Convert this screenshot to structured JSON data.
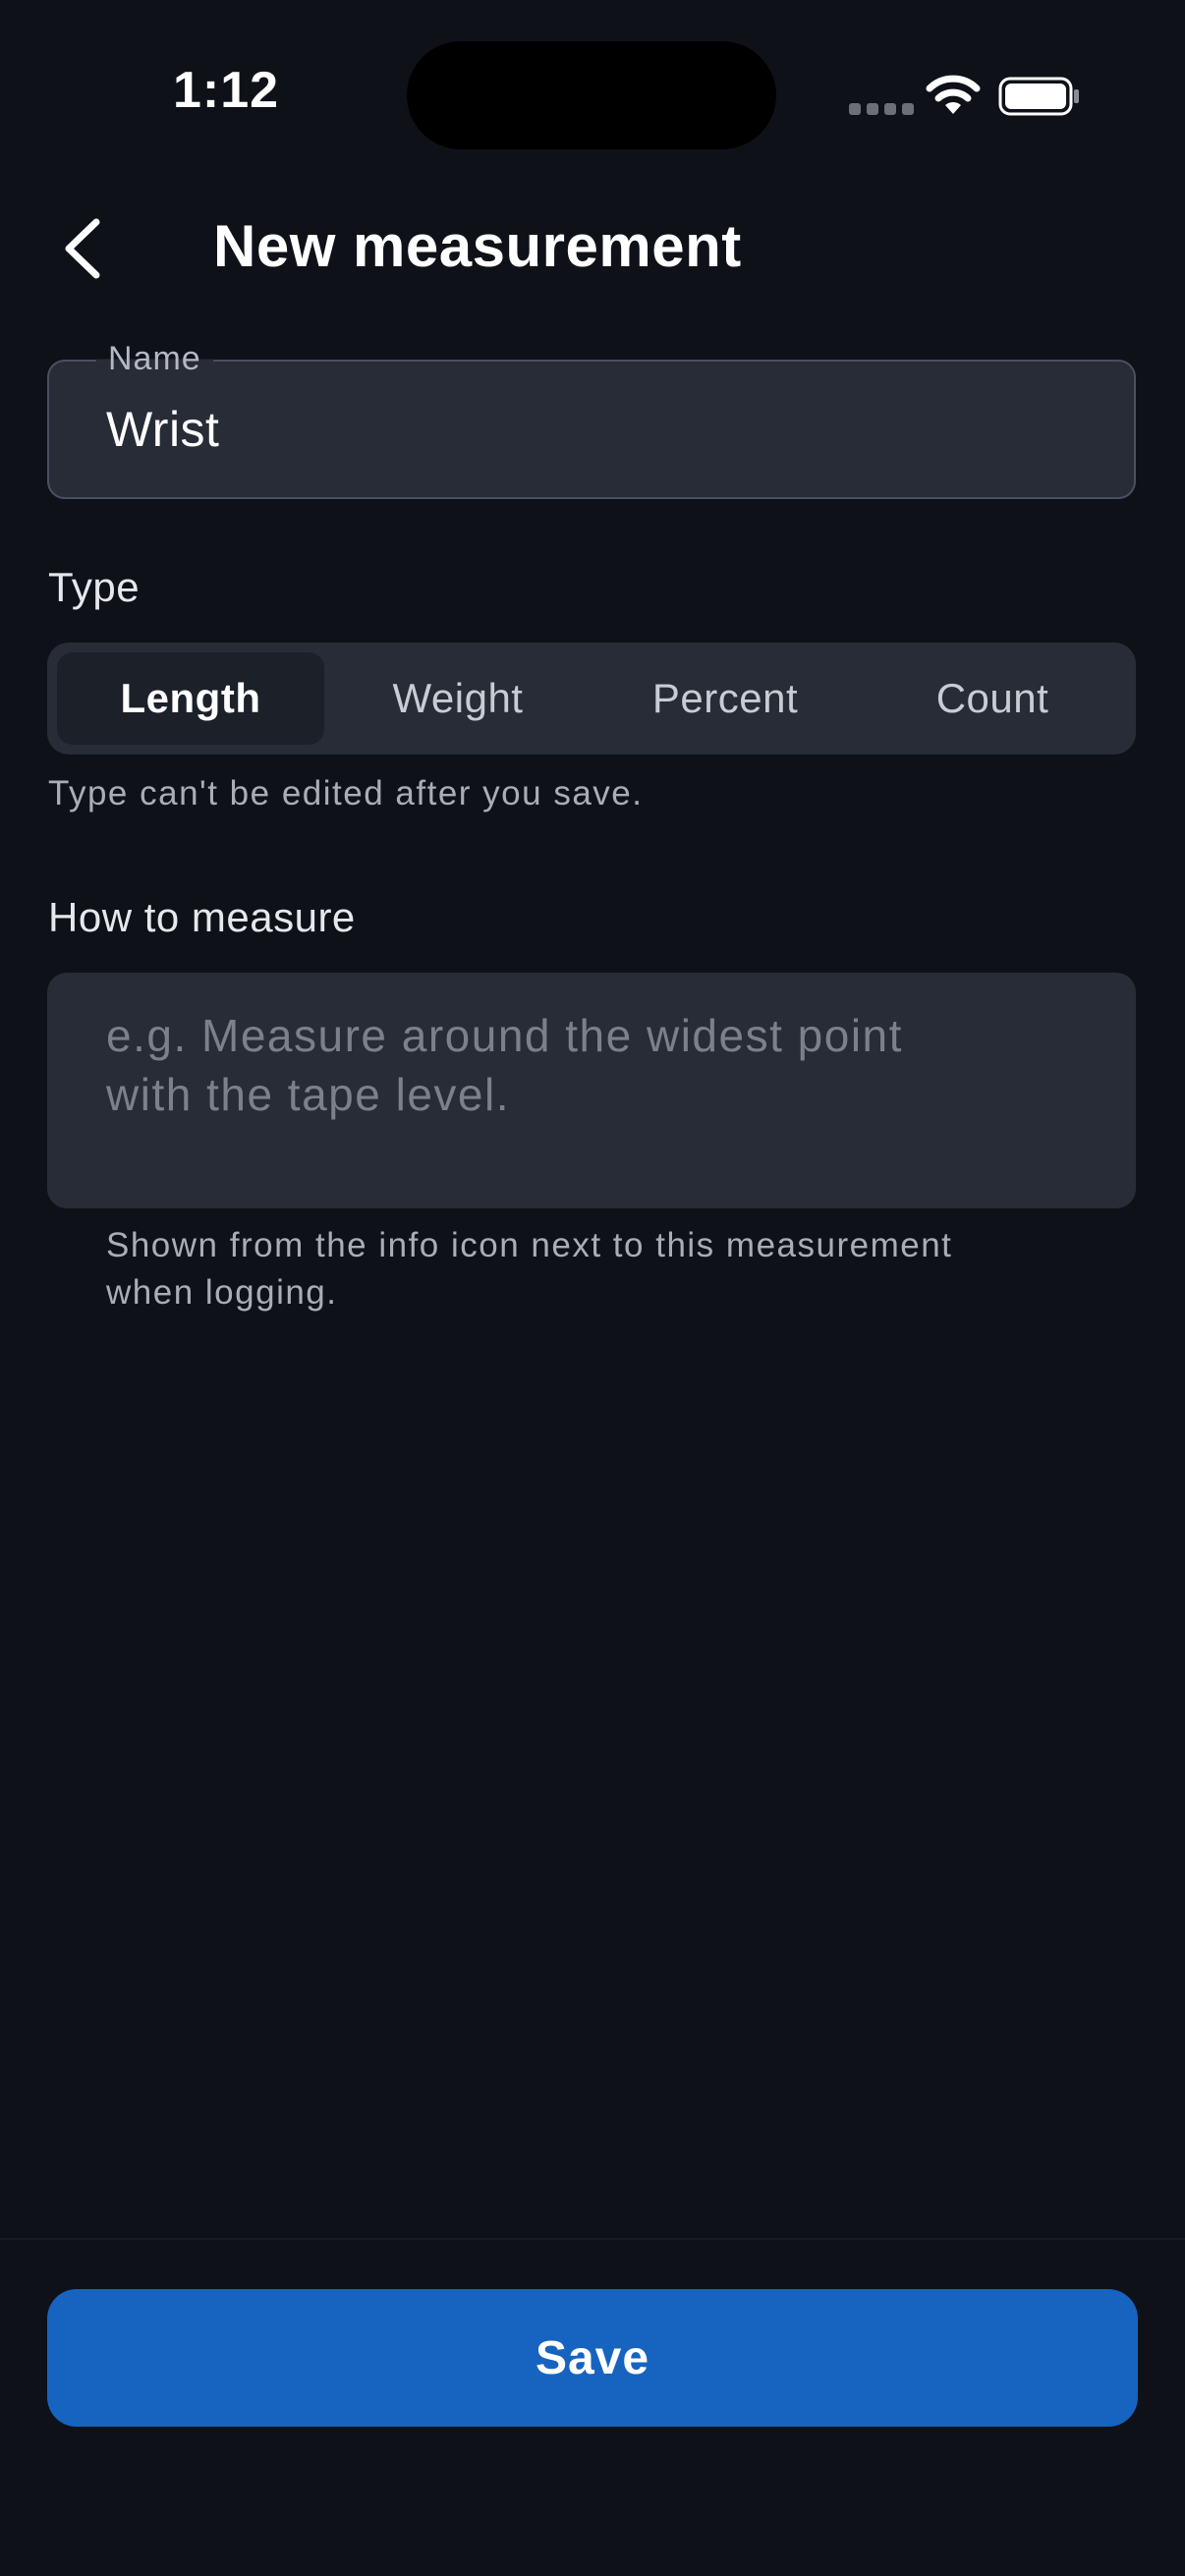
{
  "status_bar": {
    "time": "1:12"
  },
  "header": {
    "back_icon": "chevron-left-icon",
    "title": "New measurement"
  },
  "name_field": {
    "label": "Name",
    "value": "Wrist"
  },
  "type_section": {
    "label": "Type",
    "options": [
      "Length",
      "Weight",
      "Percent",
      "Count"
    ],
    "selected": "Length",
    "help_text": "Type can't be edited after you save."
  },
  "how_to_measure": {
    "label": "How to measure",
    "placeholder_line1": "e.g. Measure around the widest point",
    "placeholder_line2": "with the tape level.",
    "help_line1": "Shown from the info icon next to this measurement",
    "help_line2": "when logging."
  },
  "footer": {
    "save_label": "Save"
  },
  "colors": {
    "background": "#0e1118",
    "surface": "#272c37",
    "selected_segment": "#1b2029",
    "accent": "#1664c0"
  }
}
